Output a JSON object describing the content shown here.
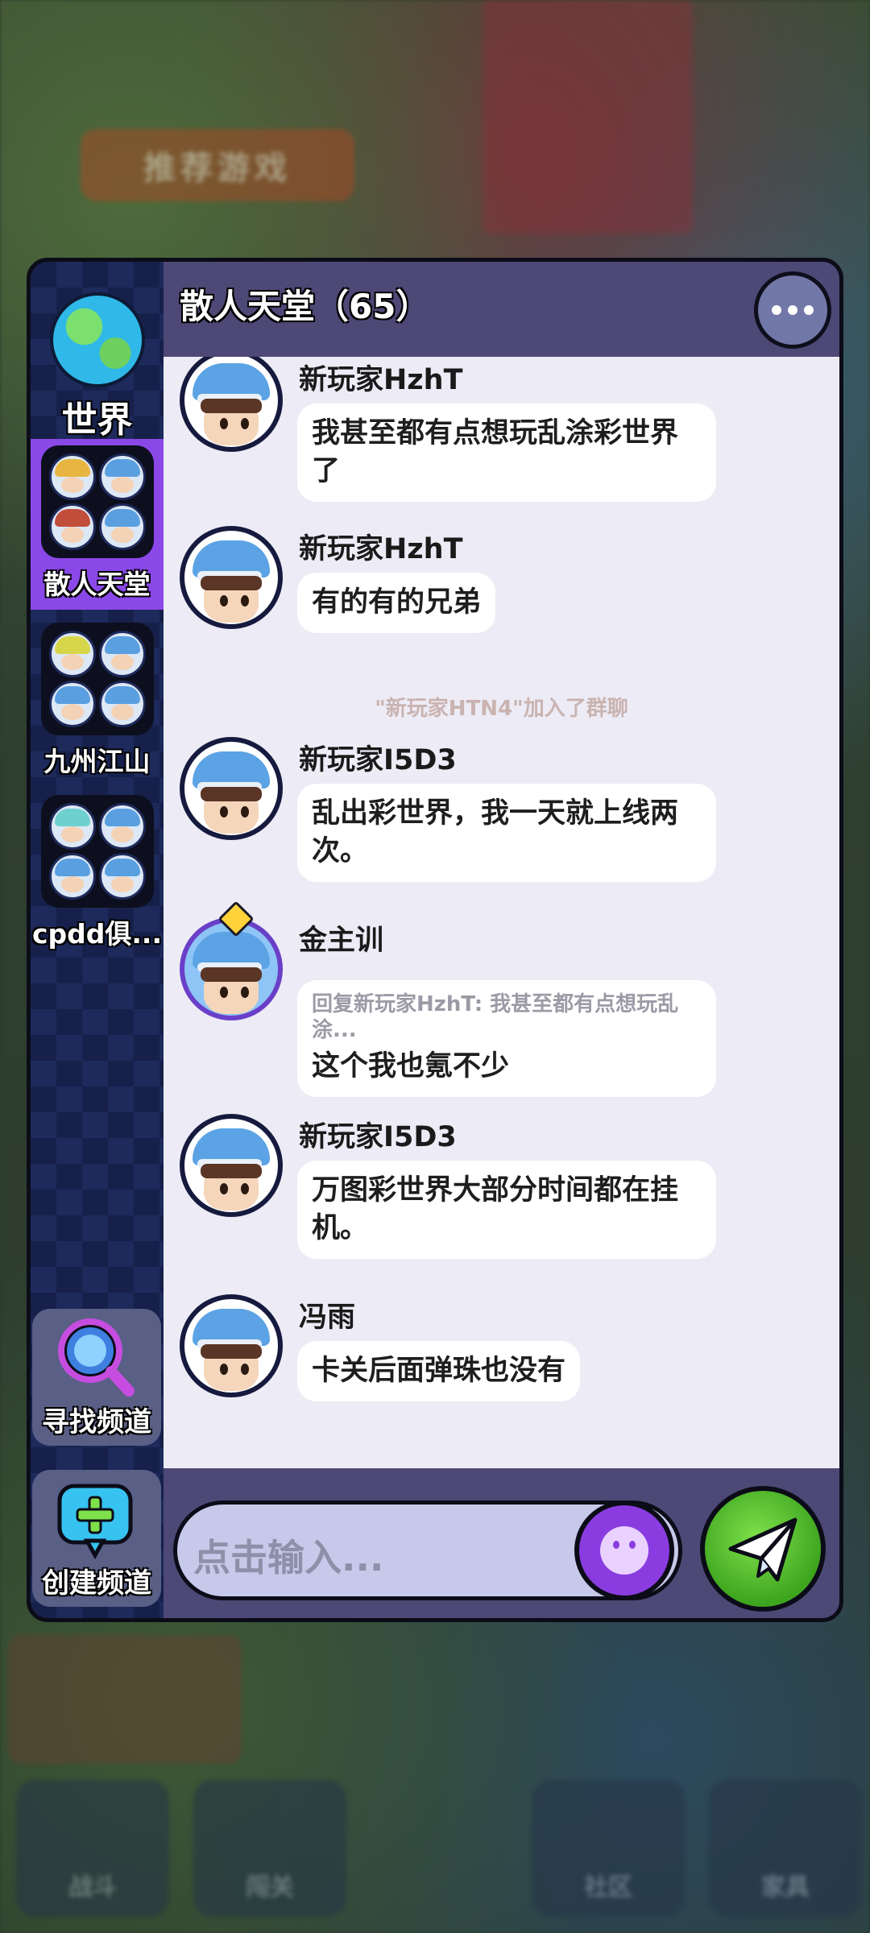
{
  "background": {
    "badge": "推荐游戏",
    "tabs": [
      "战斗",
      "闯关",
      "社区",
      "家具"
    ]
  },
  "sidebar": {
    "world_label": "世界",
    "channels": [
      {
        "label": "散人天堂",
        "active": true
      },
      {
        "label": "九州江山",
        "active": false
      },
      {
        "label": "cpdd俱...",
        "active": false
      }
    ],
    "find_channel": "寻找频道",
    "create_channel": "创建频道"
  },
  "header": {
    "title": "散人天堂（65）"
  },
  "messages": [
    {
      "name": "新玩家HzhT",
      "text": "我甚至都有点想玩乱涂彩世界了"
    },
    {
      "name": "新玩家HzhT",
      "text": "有的有的兄弟"
    },
    {
      "system": "\"新玩家HTN4\"加入了群聊"
    },
    {
      "name": "新玩家I5D3",
      "text": "乱出彩世界，我一天就上线两次。"
    },
    {
      "name": "金主训",
      "reply": "回复新玩家HzhT: 我甚至都有点想玩乱涂...",
      "text": "这个我也氪不少"
    },
    {
      "name": "新玩家I5D3",
      "text": "万图彩世界大部分时间都在挂机。"
    },
    {
      "name": "冯雨",
      "text": "卡关后面弹珠也没有"
    }
  ],
  "input": {
    "placeholder": "点击输入..."
  },
  "colors": {
    "accent_purple": "#8b48e8",
    "header_bg": "#4d4875",
    "chat_bg": "#edebf5",
    "send_green": "#3ea51f"
  }
}
